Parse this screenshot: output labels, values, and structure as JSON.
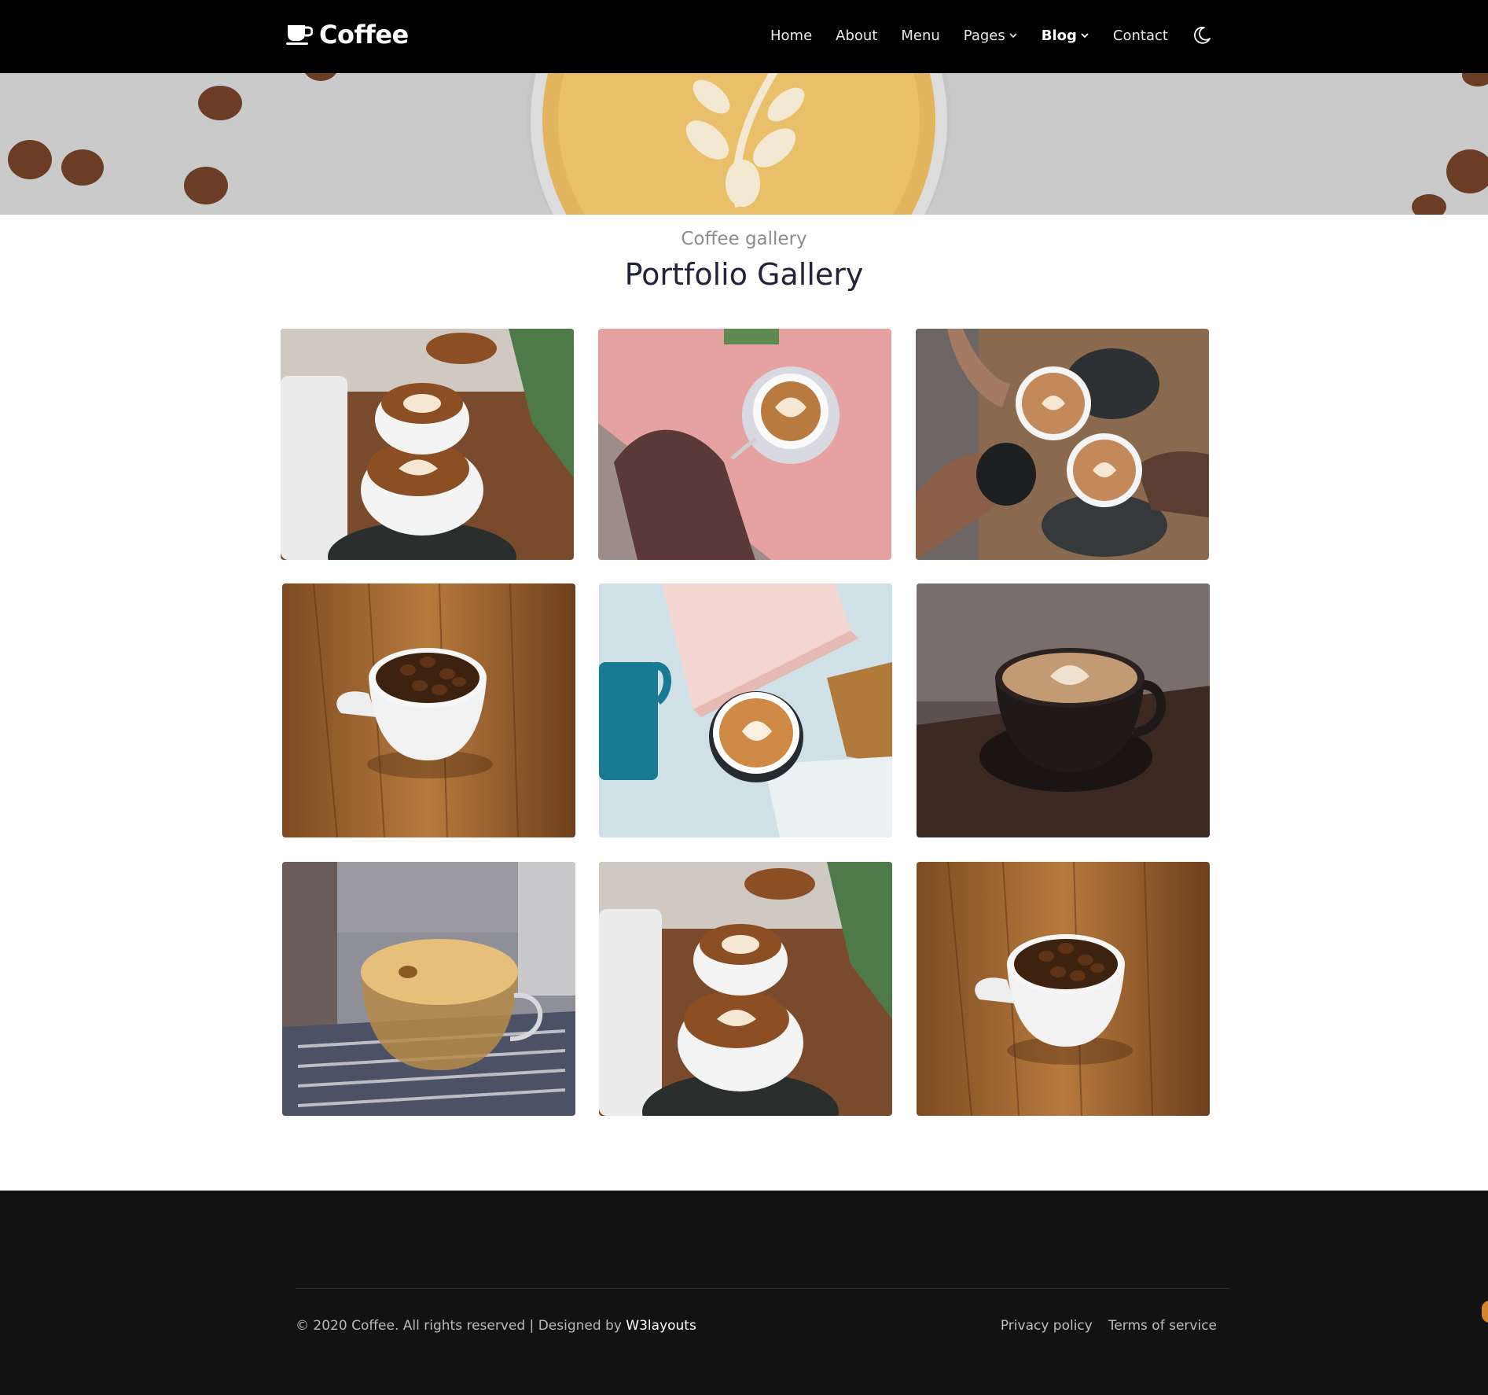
{
  "brand": {
    "name": "Coffee",
    "icon": "coffee-cup-icon"
  },
  "nav": {
    "items": [
      {
        "label": "Home",
        "has_dropdown": false,
        "active": false
      },
      {
        "label": "About",
        "has_dropdown": false,
        "active": false
      },
      {
        "label": "Menu",
        "has_dropdown": false,
        "active": false
      },
      {
        "label": "Pages",
        "has_dropdown": true,
        "active": false
      },
      {
        "label": "Blog",
        "has_dropdown": true,
        "active": true
      },
      {
        "label": "Contact",
        "has_dropdown": false,
        "active": false
      }
    ],
    "theme_toggle_icon": "moon-icon"
  },
  "section": {
    "subtitle": "Coffee gallery",
    "title": "Portfolio Gallery"
  },
  "gallery": {
    "items": [
      {
        "subject": "latte cups with plant on wooden table"
      },
      {
        "subject": "latte on pink table top view"
      },
      {
        "subject": "hands toasting coffee cups"
      },
      {
        "subject": "cup full of coffee beans on wood"
      },
      {
        "subject": "latte art with book and blue mug"
      },
      {
        "subject": "black cup latte on dark table"
      },
      {
        "subject": "espresso machine pouring into glass cup"
      },
      {
        "subject": "latte cups with plant on wooden table"
      },
      {
        "subject": "cup full of coffee beans on wood"
      }
    ]
  },
  "footer": {
    "copyright_prefix": "© 2020 Coffee. All rights reserved | Designed by",
    "designer_link": "W3layouts",
    "links": [
      "Privacy policy",
      "Terms of service"
    ]
  },
  "colors": {
    "navbar_bg": "#000000",
    "footer_bg": "#121212",
    "title_color": "#222338",
    "subtitle_color": "#8d8d8d",
    "accent": "#d5852d"
  }
}
